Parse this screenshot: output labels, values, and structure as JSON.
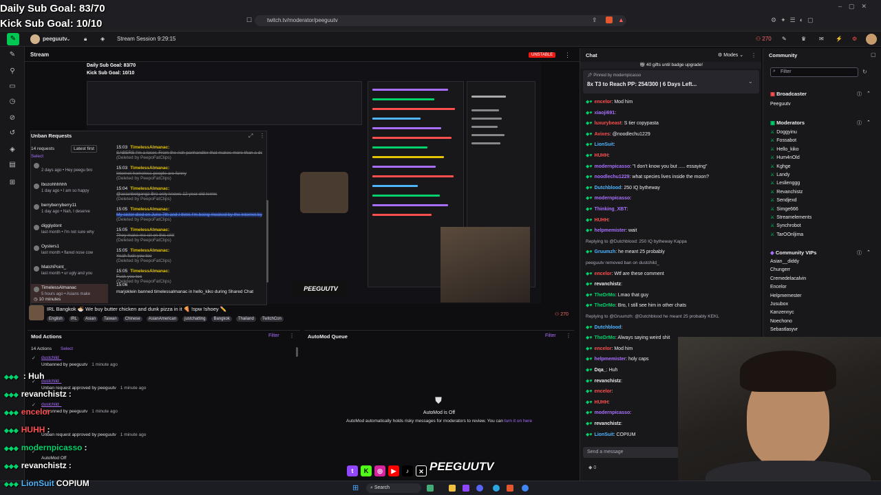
{
  "goals": {
    "daily": "Daily Sub Goal: 83/70",
    "kick": "Kick Sub Goal: 10/10"
  },
  "browser": {
    "url": "twitch.tv/moderator/peeguutv"
  },
  "topbar": {
    "channel": "peeguutv",
    "session": "Stream Session 9:29:15",
    "viewers": "270"
  },
  "stream": {
    "label": "Stream",
    "status_badge": "UNSTABLE",
    "title": "IRL Bangkok 🍜 We buy butter chicken and dunk pizza in it 🍕 !spw !shoey ✏️",
    "viewer_count": "270",
    "tags": [
      "English",
      "IRL",
      "Asian",
      "Taiwan",
      "Chinese",
      "AsianAmerican",
      "justchatting",
      "Bangkok",
      "Thailand",
      "TwitchCon"
    ]
  },
  "unban": {
    "title": "Unban Requests",
    "count": "14 requests",
    "sort": "Latest first",
    "select": "Select",
    "users": [
      {
        "name": "",
        "msg": "2 days ago • Hey peegu bro"
      },
      {
        "name": "lbozohhhhhh",
        "msg": "1 day ago • I am so happy"
      },
      {
        "name": "berryberryberry11",
        "msg": "1 day ago • Nah, I deserve"
      },
      {
        "name": "digglydont",
        "msg": "last month • I'm not sure why"
      },
      {
        "name": "Oysters1",
        "msg": "last month • flared nose cow"
      },
      {
        "name": "MatchPoint_",
        "msg": "last month • ur ugly and you"
      },
      {
        "name": "TimelessAlmanac",
        "msg": "5 hours ago • Asians make"
      }
    ],
    "footer": "10 minutes",
    "log": [
      {
        "time": "15:03",
        "user": "TimelessAlmanac:",
        "text": "SABERS I'm a loser. From the rich panhandler that makes more than a doctor.",
        "status": "(Deleted by PeepoFatClips)"
      },
      {
        "time": "15:03",
        "user": "TimelessAlmanac:",
        "text": "Internet homeless people are funny",
        "status": "(Deleted by PeepoFatClips)"
      },
      {
        "time": "15:04",
        "user": "TimelessAlmanac:",
        "text": "@asianbolgangz Bro only knows 12 year old terms",
        "status": "(Deleted by PeepoFatClips)"
      },
      {
        "time": "15:05",
        "user": "TimelessAlmanac:",
        "text": "My sister died on June 7th and I think I'm being mocked by the internet by 6/7",
        "status": "(Deleted by PeepoFatClips)"
      },
      {
        "time": "15:05",
        "user": "TimelessAlmanac:",
        "text": "They make me sit on this shit",
        "status": "(Deleted by PeepoFatClips)"
      },
      {
        "time": "15:05",
        "user": "TimelessAlmanac:",
        "text": "Yeah fuck you too",
        "status": "(Deleted by PeepoFatClips)"
      },
      {
        "time": "15:05",
        "user": "TimelessAlmanac:",
        "text": "Fuck you too",
        "status": "(Deleted by PeepoFatClips)"
      }
    ],
    "ban_line": "marjoklein banned timelessalmanac in hello_kiko during Shared Chat",
    "ban_time": "15:06"
  },
  "modactions": {
    "title": "Mod Actions",
    "filter": "Filter",
    "count": "14 Actions",
    "select": "Select",
    "items": [
      {
        "user": "dustchild_",
        "action": "Unbanned by peeguutv",
        "time": "1 minute ago"
      },
      {
        "user": "dustchild_",
        "action": "Unban request approved by peeguutv",
        "time": "1 minute ago"
      },
      {
        "user": "dustchild_",
        "action": "Unbanned by peeguutv",
        "time": "1 minute ago"
      },
      {
        "user": "",
        "action": "Unban request approved by peeguutv",
        "time": "1 minute ago"
      },
      {
        "user": "",
        "action": "AutoMod Off",
        "time": ""
      }
    ]
  },
  "automod": {
    "title": "AutoMod Queue",
    "filter": "Filter",
    "status": "AutoMod is Off",
    "desc": "AutoMod automatically holds risky messages for moderators to review. You can",
    "link": "turn it on here"
  },
  "chat": {
    "title": "Chat",
    "modes": "Modes",
    "gift_banner": "40 gifts until badge upgrade!",
    "pinned_by": "Pinned by modernpicasso",
    "pinned_text": "8x T3 to Reach PP: 254/300 | 6 Days Left...",
    "messages": [
      {
        "user": "encelor",
        "color": "#ff4f4f",
        "text": "Mod him"
      },
      {
        "user": "xiaoji691",
        "color": "#a970ff",
        "text": ""
      },
      {
        "user": "luxurybeast",
        "color": "#ff4f4f",
        "text": "S tier copypasta"
      },
      {
        "user": "Avixes",
        "color": "#ff4f4f",
        "text": "@noodlechu1229"
      },
      {
        "user": "LionSuit",
        "color": "#4db6ff",
        "text": ""
      },
      {
        "user": "HUHH",
        "color": "#ff4f4f",
        "text": ""
      },
      {
        "user": "modernpicasso",
        "color": "#a970ff",
        "text": "\"I don't know you but ..... essaying\""
      },
      {
        "user": "noodlechu1229",
        "color": "#a970ff",
        "text": "what species lives inside the moon?"
      },
      {
        "user": "Dutchblood",
        "color": "#4db6ff",
        "text": "250 IQ bytheway"
      },
      {
        "user": "modernpicasso",
        "color": "#a970ff",
        "text": ""
      },
      {
        "user": "Thinking_XBT",
        "color": "#a970ff",
        "text": ""
      },
      {
        "user": "HUHH",
        "color": "#ff4f4f",
        "text": ""
      },
      {
        "user": "helpmemister",
        "color": "#a970ff",
        "text": "wait"
      },
      {
        "user": "Replying to @Dutchblood: 250 IQ bytheway Kappa",
        "color": "#adadb8",
        "text": ""
      },
      {
        "user": "Gruumzh",
        "color": "#4db6ff",
        "text": "he meant 25 probably"
      },
      {
        "user": "peeguutv removed ban on dustchild_",
        "color": "#adadb8",
        "text": ""
      },
      {
        "user": "encelor",
        "color": "#ff4f4f",
        "text": "Wtf are these comment"
      },
      {
        "user": "revanchistz",
        "color": "#efeff1",
        "text": ""
      },
      {
        "user": "TheDrMo",
        "color": "#00d36b",
        "text": "Lmao that guy"
      },
      {
        "user": "TheDrMo",
        "color": "#00d36b",
        "text": "Bro, I still see him in other chats"
      },
      {
        "user": "Replying to @Gruumzh: @Dutchblood he meant 25 probably KEKL",
        "color": "#adadb8",
        "text": ""
      },
      {
        "user": "Dutchblood",
        "color": "#4db6ff",
        "text": ""
      },
      {
        "user": "TheDrMo",
        "color": "#00d36b",
        "text": "Always saying weird shit"
      },
      {
        "user": "encelor",
        "color": "#ff4f4f",
        "text": "Mod him"
      },
      {
        "user": "helpmemister",
        "color": "#a970ff",
        "text": "holy caps"
      },
      {
        "user": "Dqa_",
        "color": "#efeff1",
        "text": "Huh"
      },
      {
        "user": "revanchistz",
        "color": "#efeff1",
        "text": ""
      },
      {
        "user": "encelor",
        "color": "#ff4f4f",
        "text": ""
      },
      {
        "user": "HUHH",
        "color": "#ff4f4f",
        "text": ""
      },
      {
        "user": "modernpicasso",
        "color": "#a970ff",
        "text": ""
      },
      {
        "user": "revanchistz",
        "color": "#efeff1",
        "text": ""
      },
      {
        "user": "LionSuit",
        "color": "#4db6ff",
        "text": "COPIUM"
      }
    ],
    "input_placeholder": "Send a message",
    "points": "0"
  },
  "community": {
    "title": "Community",
    "filter_placeholder": "Filter",
    "broadcaster_head": "Broadcaster",
    "broadcaster": "Peeguutv",
    "moderators_head": "Moderators",
    "moderators": [
      "Doggyinu",
      "Fossabot",
      "Hello_kiko",
      "Hum4nOld",
      "Kghge",
      "Landy",
      "Leslienggg",
      "Revanchistz",
      "Sendjexd",
      "Simge666",
      "Streamelements",
      "Synchrobot",
      "TarOOnljima"
    ],
    "vips_head": "Community VIPs",
    "vips": [
      "Asian__diddy",
      "Chungerr",
      "Cremedelacalvin",
      "Encelor",
      "Helpmemester",
      "Jusubox",
      "Kanzennyc",
      "Noechono",
      "Sebastlasyvr"
    ]
  },
  "overlay_chat": [
    {
      "user": "",
      "text": ": Huh",
      "color": "#a970ff"
    },
    {
      "user": "revanchistz",
      "text": ":",
      "color": "#ffffff"
    },
    {
      "user": "encelor",
      "text": "",
      "color": "#ff4f4f"
    },
    {
      "user": "HUHH",
      "text": ":",
      "color": "#ff4f4f"
    },
    {
      "user": "modernpicasso",
      "text": ":",
      "color": "#00d36b"
    },
    {
      "user": "revanchistz",
      "text": ":",
      "color": "#ffffff"
    },
    {
      "user": "LionSuit",
      "text": "COPIUM",
      "color": "#4db6ff"
    }
  ],
  "socials_brand": "PEEGUUTV",
  "taskbar": {
    "search": "Search"
  }
}
